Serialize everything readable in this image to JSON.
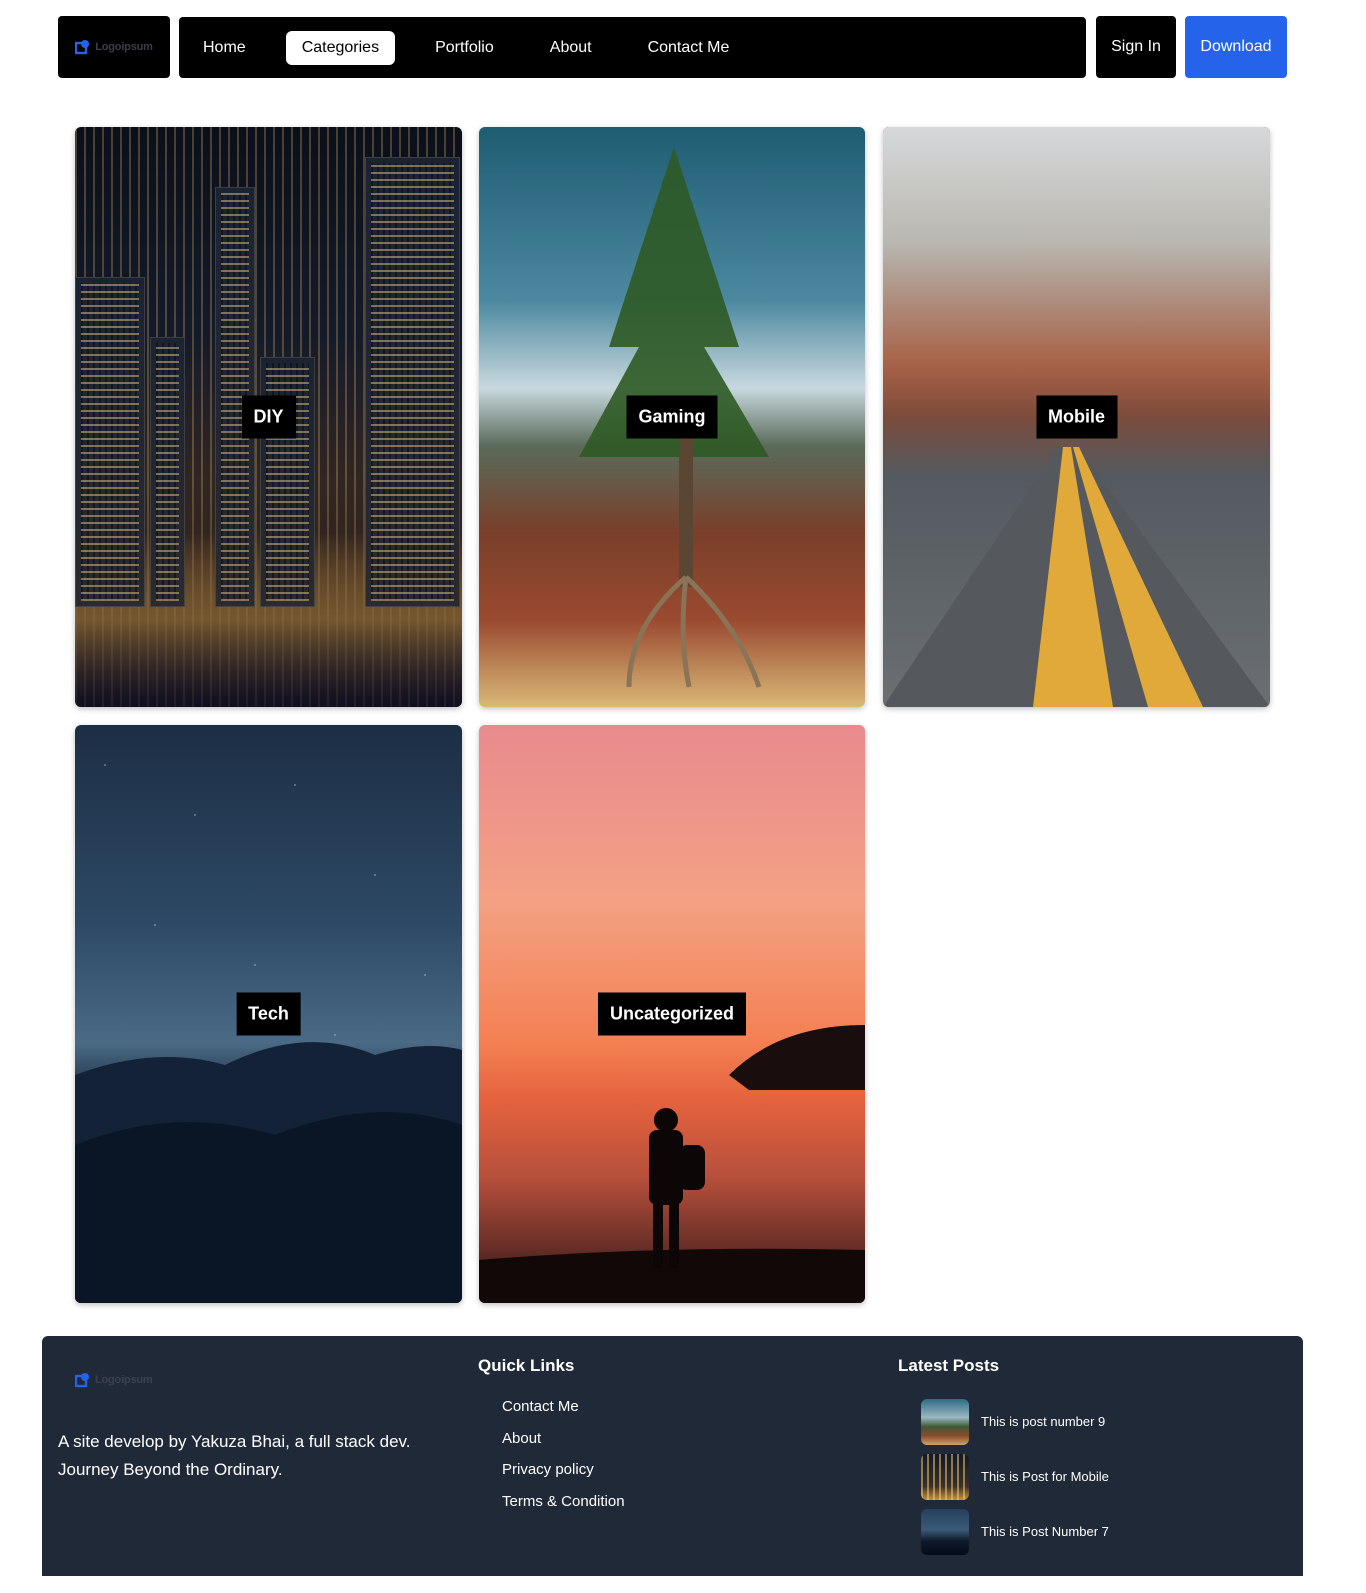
{
  "header": {
    "logo_text": "Logoipsum",
    "nav": [
      {
        "label": "Home"
      },
      {
        "label": "Categories",
        "active": true
      },
      {
        "label": "Portfolio"
      },
      {
        "label": "About"
      },
      {
        "label": "Contact Me"
      }
    ],
    "signin_label": "Sign In",
    "download_label": "Download"
  },
  "categories": [
    {
      "label": "DIY"
    },
    {
      "label": "Gaming"
    },
    {
      "label": "Mobile"
    },
    {
      "label": "Tech"
    },
    {
      "label": "Uncategorized"
    }
  ],
  "footer": {
    "logo_text": "Logoipsum",
    "description": "A site develop by Yakuza Bhai, a full stack dev. Journey Beyond the Ordinary.",
    "quick_links_title": "Quick Links",
    "quick_links": [
      "Contact Me",
      "About",
      "Privacy policy",
      "Terms & Condition"
    ],
    "latest_posts_title": "Latest Posts",
    "latest_posts": [
      {
        "title": "This is post number 9"
      },
      {
        "title": "This is Post for Mobile"
      },
      {
        "title": "This is Post Number 7"
      }
    ]
  },
  "colors": {
    "accent": "#2563eb",
    "footer_bg": "#1f2937",
    "nav_bg": "#000000"
  }
}
